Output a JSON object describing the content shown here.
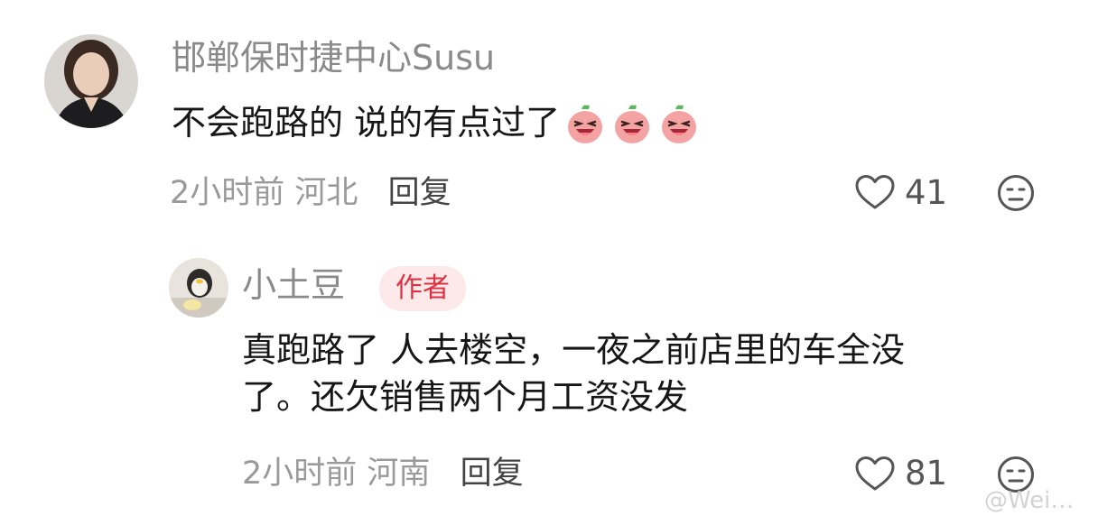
{
  "comments": [
    {
      "username": "邯郸保时捷中心Susu",
      "text": "不会跑路的 说的有点过了",
      "emoji": [
        "laughing-face-emoji",
        "laughing-face-emoji",
        "laughing-face-emoji"
      ],
      "time": "2小时前",
      "location": "河北",
      "reply_label": "回复",
      "likes": "41"
    },
    {
      "username": "小土豆",
      "badge": "作者",
      "text_line1": "真跑路了 人去楼空，一夜之前店里的车全没",
      "text_line2": "了。还欠销售两个月工资没发",
      "time": "2小时前",
      "location": "河南",
      "reply_label": "回复",
      "likes": "81"
    }
  ],
  "watermark": "@Wei…",
  "colors": {
    "badge_text": "#e0303f",
    "badge_bg": "#fde8ea",
    "username": "#8a8a8a",
    "meta": "#9a9a9a"
  }
}
